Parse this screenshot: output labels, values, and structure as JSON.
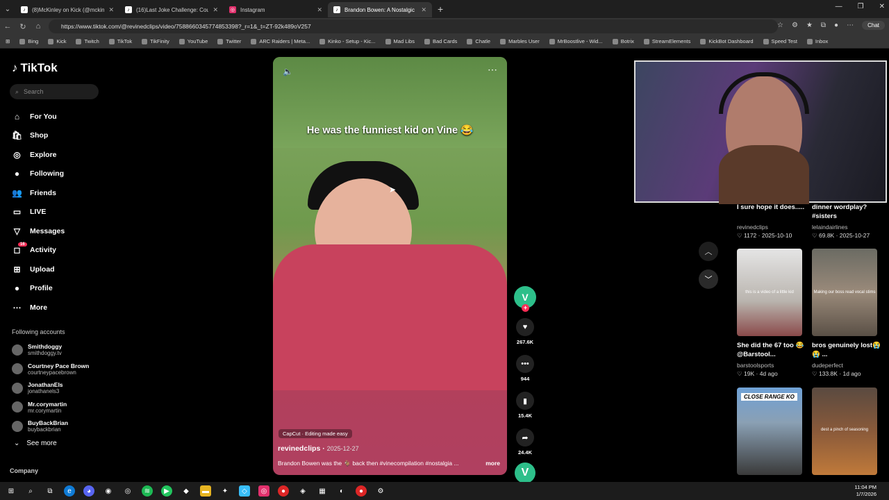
{
  "browser": {
    "tabs": [
      {
        "title": "(8)McKinley on Kick (@mckinley.ti",
        "icon": "tiktok-icon"
      },
      {
        "title": "(16)Last Joke Challenge: Couple C",
        "icon": "tiktok-icon"
      },
      {
        "title": "Instagram",
        "icon": "instagram-icon"
      },
      {
        "title": "Brandon Bowen: A Nostalgic",
        "icon": "tiktok-icon"
      }
    ],
    "url": "https://www.tiktok.com/@revinedclips/video/7588660345774853398?_r=1&_t=ZT-92k489oV257",
    "chat_label": "Chat",
    "bookmarks": [
      "Bing",
      "Kick",
      "Twitch",
      "TikTok",
      "TikFinity",
      "YouTube",
      "Twitter",
      "ARC Raiders | Meta...",
      "Kinko - Setup - Kic...",
      "Mad Libs",
      "Bad Cards",
      "Chatle",
      "Marbles User",
      "MrBoostlive - Wid...",
      "Botrix",
      "StreamElements",
      "KickBot Dashboard",
      "Speed Test",
      "Inbox"
    ]
  },
  "sidebar": {
    "logo": "TikTok",
    "search_placeholder": "Search",
    "nav": [
      {
        "label": "For You",
        "icon": "home-icon",
        "glyph": "⌂"
      },
      {
        "label": "Shop",
        "icon": "shop-icon",
        "glyph": "🛍"
      },
      {
        "label": "Explore",
        "icon": "compass-icon",
        "glyph": "◎"
      },
      {
        "label": "Following",
        "icon": "avatar-icon",
        "glyph": "●"
      },
      {
        "label": "Friends",
        "icon": "friends-icon",
        "glyph": "👥"
      },
      {
        "label": "LIVE",
        "icon": "live-icon",
        "glyph": "▭"
      },
      {
        "label": "Messages",
        "icon": "messages-icon",
        "glyph": "▽"
      },
      {
        "label": "Activity",
        "icon": "activity-icon",
        "glyph": "◻"
      },
      {
        "label": "Upload",
        "icon": "upload-icon",
        "glyph": "⊞"
      },
      {
        "label": "Profile",
        "icon": "profile-icon",
        "glyph": "●"
      },
      {
        "label": "More",
        "icon": "more-icon",
        "glyph": "⋯"
      }
    ],
    "activity_badge": "16",
    "following_title": "Following accounts",
    "following": [
      {
        "name": "Smithdoggy",
        "handle": "smithdoggy.tv"
      },
      {
        "name": "Courtney Pace Brown",
        "handle": "courtneypacebrown"
      },
      {
        "name": "JonathanEls",
        "handle": "jonathanels3"
      },
      {
        "name": "Mr.corymartin",
        "handle": "mr.corymartin"
      },
      {
        "name": "BuyBackBrian",
        "handle": "buybackbrian"
      }
    ],
    "see_more": "See more",
    "company": "Company"
  },
  "video": {
    "caption": "He was the funniest kid on Vine 😂",
    "capcut": "CapCut · Editing made easy",
    "author": "revinedclips",
    "date": "2025-12-27",
    "description": "Brandon Bowen was the 🐐 back then #vinecompilation #nostalgia ...",
    "more": "more",
    "likes": "267.6K",
    "comments": "944",
    "saves": "15.4K",
    "shares": "24.4K"
  },
  "recommendations": [
    {
      "title": "I sure hope it does.....",
      "user": "revinedclips",
      "likes": "1172",
      "date": "2025-10-10"
    },
    {
      "title": "dinner wordplay? #sisters",
      "user": "lelaindairlines",
      "likes": "69.8K",
      "date": "2025-10-27"
    },
    {
      "title": "She did the 67 too 😂 @Barstool...",
      "user": "barstoolsports",
      "likes": "19K",
      "date": "4d ago",
      "overlay": "this is a video of a little kid"
    },
    {
      "title": "bros genuinely lost😭😭 ...",
      "user": "dudeperfect",
      "likes": "133.8K",
      "date": "1d ago",
      "overlay": "Making our boss read vocal stims"
    },
    {
      "label": "CLOSE RANGE KO"
    },
    {
      "overlay": "dest a pinch of seasoning"
    }
  ],
  "taskbar": {
    "time": "11:04 PM",
    "date": "1/7/2026"
  }
}
